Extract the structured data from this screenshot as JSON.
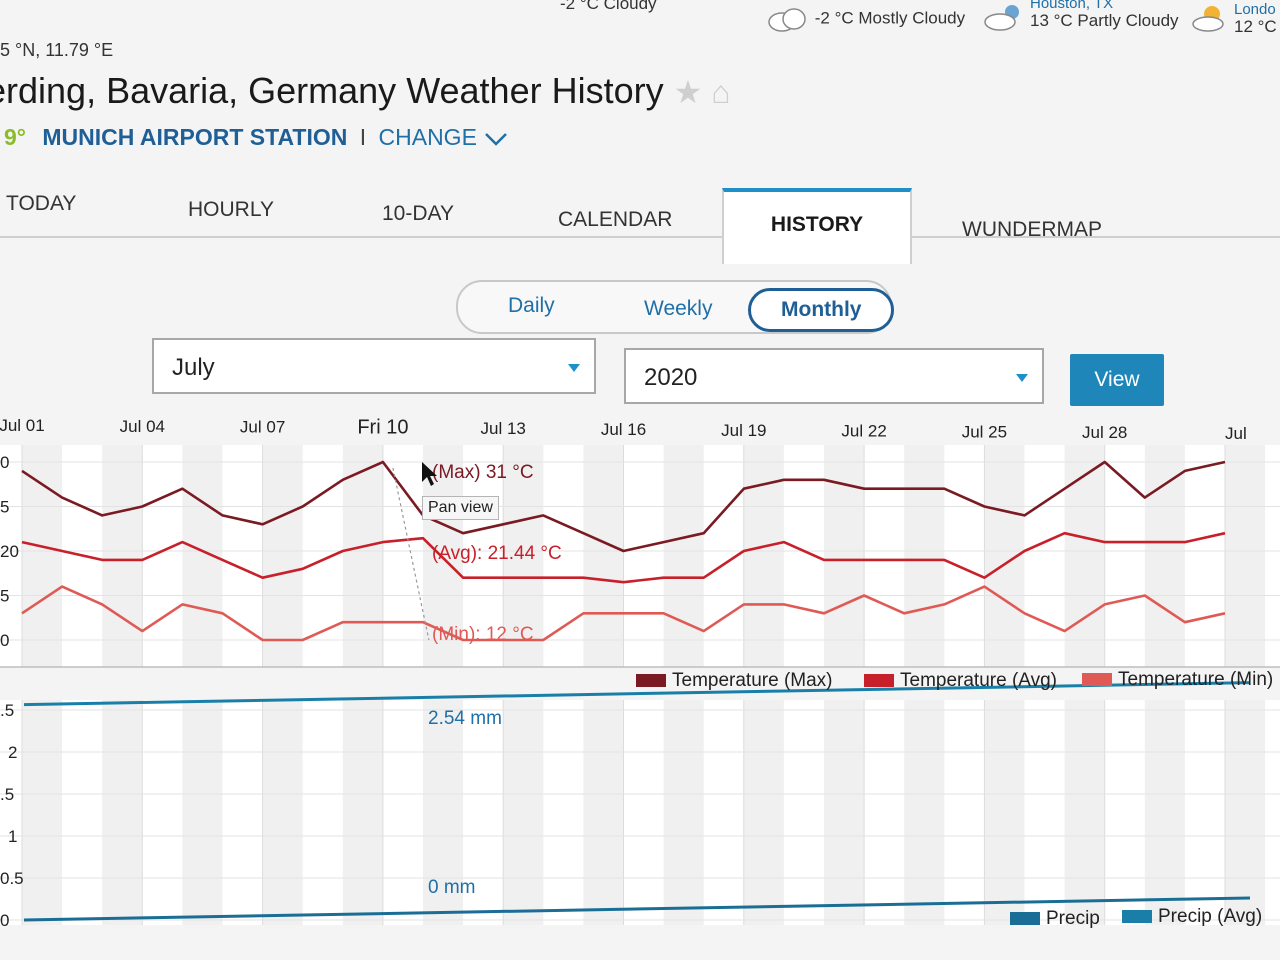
{
  "top_cities": [
    {
      "name": "",
      "weather": "-2 °C Cloudy",
      "partial": true
    },
    {
      "name": "",
      "weather": "-2 °C Mostly Cloudy"
    },
    {
      "name": "Houston, TX",
      "weather": "13 °C Partly Cloudy"
    },
    {
      "name": "Londo",
      "weather": "12 °C"
    }
  ],
  "location": {
    "coordinates": "5 °N, 11.79 °E",
    "title": "erding, Bavaria, Germany Weather History",
    "current_temp": "9°",
    "station": "MUNICH AIRPORT STATION",
    "separator": "I",
    "change_label": "CHANGE"
  },
  "tabs": [
    {
      "label": "TODAY"
    },
    {
      "label": "HOURLY"
    },
    {
      "label": "10-DAY"
    },
    {
      "label": "CALENDAR"
    },
    {
      "label": "HISTORY",
      "active": true
    },
    {
      "label": "WUNDERMAP"
    }
  ],
  "period_toggle": {
    "options": [
      "Daily",
      "Weekly",
      "Monthly"
    ],
    "selected": "Monthly"
  },
  "month_select": {
    "value": "July"
  },
  "year_select": {
    "value": "2020"
  },
  "view_button": "View",
  "tooltip": "Pan view",
  "colors": {
    "max": "#7a1a22",
    "avg": "#c8202a",
    "min": "#e05a55",
    "precip": "#1a7fa8",
    "accent": "#1e90c8"
  },
  "chart_data": [
    {
      "type": "line",
      "x_tick_labels": [
        "Jul 01",
        "Jul 04",
        "Jul 07",
        "Fri 10",
        "Jul 13",
        "Jul 16",
        "Jul 19",
        "Jul 22",
        "Jul 25",
        "Jul 28",
        "Jul"
      ],
      "y_tick_labels": [
        "0",
        "5",
        "20",
        "5",
        "0"
      ],
      "ylim": [
        10,
        30
      ],
      "x": [
        1,
        2,
        3,
        4,
        5,
        6,
        7,
        8,
        9,
        10,
        11,
        12,
        13,
        14,
        15,
        16,
        17,
        18,
        19,
        20,
        21,
        22,
        23,
        24,
        25,
        26,
        27,
        28,
        29,
        30,
        31
      ],
      "series": [
        {
          "name": "Temperature (Max)",
          "values": [
            29,
            26,
            24,
            25,
            27,
            24,
            23,
            25,
            28,
            30,
            24,
            22,
            23,
            24,
            22,
            20,
            21,
            22,
            27,
            28,
            28,
            27,
            27,
            27,
            25,
            24,
            27,
            30,
            26,
            29,
            30
          ]
        },
        {
          "name": "Temperature (Avg)",
          "values": [
            21,
            20,
            19,
            19,
            21,
            19,
            17,
            18,
            20,
            21,
            21.44,
            17,
            17,
            17,
            17,
            16.5,
            17,
            17,
            20,
            21,
            19,
            19,
            19,
            19,
            17,
            20,
            22,
            21,
            21,
            21,
            22
          ]
        },
        {
          "name": "Temperature (Min)",
          "values": [
            13,
            16,
            14,
            11,
            14,
            13,
            10,
            10,
            12,
            12,
            12,
            10,
            10,
            10,
            13,
            13,
            13,
            11,
            14,
            14,
            13,
            15,
            13,
            14,
            16,
            13,
            11,
            14,
            15,
            12,
            13
          ]
        }
      ],
      "annotations": [
        "(Max) 31 °C",
        "(Avg): 21.44 °C",
        "(Min): 12 °C"
      ],
      "grid": true,
      "legend": "bottom-right"
    },
    {
      "type": "line",
      "x_tick_labels": [],
      "y_tick_labels": [
        ".5",
        "2",
        ".5",
        "1",
        "0.5",
        "0"
      ],
      "ylim": [
        0,
        2.5
      ],
      "x": [
        1,
        31
      ],
      "series": [
        {
          "name": "Precip",
          "values": [
            0,
            0
          ]
        },
        {
          "name": "Precip (Avg)",
          "values": [
            2.54,
            2.54
          ]
        }
      ],
      "annotations": [
        "2.54 mm",
        "0 mm"
      ],
      "grid": true,
      "legend": "bottom-right"
    }
  ]
}
